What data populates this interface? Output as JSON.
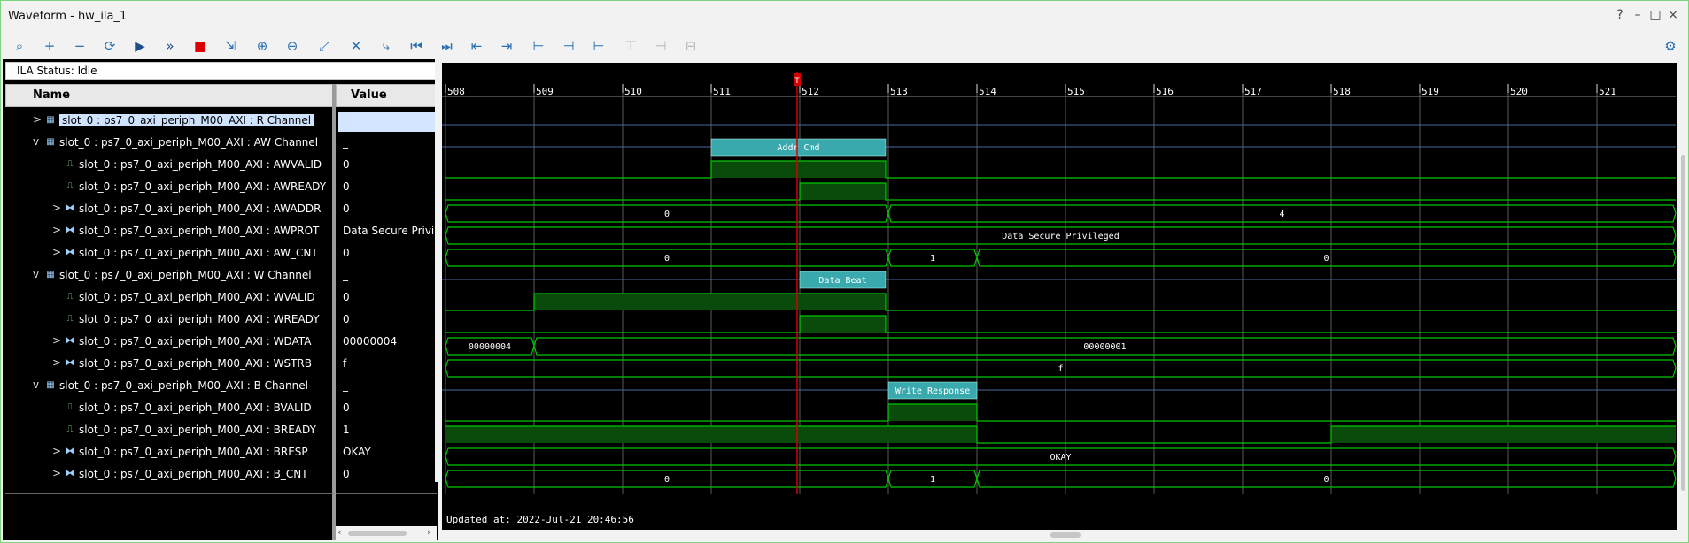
{
  "window": {
    "title": "Waveform - hw_ila_1",
    "controls": [
      "?",
      "–",
      "□",
      "×"
    ]
  },
  "toolbar": {
    "buttons": [
      {
        "name": "search-icon",
        "glyph": "⌕"
      },
      {
        "name": "add-icon",
        "glyph": "+"
      },
      {
        "name": "remove-icon",
        "glyph": "−"
      },
      {
        "name": "auto-retrigger-icon",
        "glyph": "⟳"
      },
      {
        "name": "run-trigger-icon",
        "glyph": "▶"
      },
      {
        "name": "run-immediate-icon",
        "glyph": "»"
      },
      {
        "name": "stop-icon",
        "glyph": "■"
      },
      {
        "name": "export-icon",
        "glyph": "⇲"
      },
      {
        "name": "zoom-in-icon",
        "glyph": "⊕"
      },
      {
        "name": "zoom-out-icon",
        "glyph": "⊖"
      },
      {
        "name": "zoom-fit-icon",
        "glyph": "⤢"
      },
      {
        "name": "cursor-icon",
        "glyph": "✕"
      },
      {
        "name": "go-to-cursor-icon",
        "glyph": "⤷"
      },
      {
        "name": "go-to-start-icon",
        "glyph": "⏮"
      },
      {
        "name": "go-to-end-icon",
        "glyph": "⏭"
      },
      {
        "name": "prev-transition-icon",
        "glyph": "⇤"
      },
      {
        "name": "next-transition-icon",
        "glyph": "⇥"
      },
      {
        "name": "add-marker-icon",
        "glyph": "⊢"
      },
      {
        "name": "prev-marker-icon",
        "glyph": "⊣"
      },
      {
        "name": "next-marker-icon",
        "glyph": "⊢"
      },
      {
        "name": "swap-cursors-icon",
        "glyph": "⊤"
      },
      {
        "name": "snap-icon",
        "glyph": "⊣"
      },
      {
        "name": "center-icon",
        "glyph": "⊟"
      }
    ],
    "settings_icon": "gear-icon"
  },
  "ila_status": "ILA Status:  Idle",
  "columns": {
    "name": "Name",
    "value": "Value"
  },
  "signals": [
    {
      "name": "slot_0 : ps7_0_axi_periph_M00_AXI : R Channel",
      "value": "_",
      "level": 0,
      "expander": ">",
      "icon": "channel",
      "selected": true
    },
    {
      "name": "slot_0 : ps7_0_axi_periph_M00_AXI : AW Channel",
      "value": "_",
      "level": 0,
      "expander": "v",
      "icon": "channel"
    },
    {
      "name": "slot_0 : ps7_0_axi_periph_M00_AXI : AWVALID",
      "value": "0",
      "level": 1,
      "expander": "",
      "icon": "bit"
    },
    {
      "name": "slot_0 : ps7_0_axi_periph_M00_AXI : AWREADY",
      "value": "0",
      "level": 1,
      "expander": "",
      "icon": "bit"
    },
    {
      "name": "slot_0 : ps7_0_axi_periph_M00_AXI : AWADDR",
      "value": "0",
      "level": 1,
      "expander": ">",
      "icon": "bus"
    },
    {
      "name": "slot_0 : ps7_0_axi_periph_M00_AXI : AWPROT",
      "value": "Data Secure Privileged",
      "level": 1,
      "expander": ">",
      "icon": "bus"
    },
    {
      "name": "slot_0 : ps7_0_axi_periph_M00_AXI : AW_CNT",
      "value": "0",
      "level": 1,
      "expander": ">",
      "icon": "bus"
    },
    {
      "name": "slot_0 : ps7_0_axi_periph_M00_AXI : W Channel",
      "value": "_",
      "level": 0,
      "expander": "v",
      "icon": "channel"
    },
    {
      "name": "slot_0 : ps7_0_axi_periph_M00_AXI : WVALID",
      "value": "0",
      "level": 1,
      "expander": "",
      "icon": "bit"
    },
    {
      "name": "slot_0 : ps7_0_axi_periph_M00_AXI : WREADY",
      "value": "0",
      "level": 1,
      "expander": "",
      "icon": "bit"
    },
    {
      "name": "slot_0 : ps7_0_axi_periph_M00_AXI : WDATA",
      "value": "00000004",
      "level": 1,
      "expander": ">",
      "icon": "bus"
    },
    {
      "name": "slot_0 : ps7_0_axi_periph_M00_AXI : WSTRB",
      "value": "f",
      "level": 1,
      "expander": ">",
      "icon": "bus"
    },
    {
      "name": "slot_0 : ps7_0_axi_periph_M00_AXI : B Channel",
      "value": "_",
      "level": 0,
      "expander": "v",
      "icon": "channel"
    },
    {
      "name": "slot_0 : ps7_0_axi_periph_M00_AXI : BVALID",
      "value": "0",
      "level": 1,
      "expander": "",
      "icon": "bit"
    },
    {
      "name": "slot_0 : ps7_0_axi_periph_M00_AXI : BREADY",
      "value": "1",
      "level": 1,
      "expander": "",
      "icon": "bit"
    },
    {
      "name": "slot_0 : ps7_0_axi_periph_M00_AXI : BRESP",
      "value": "OKAY",
      "level": 1,
      "expander": ">",
      "icon": "bus"
    },
    {
      "name": "slot_0 : ps7_0_axi_periph_M00_AXI : B_CNT",
      "value": "0",
      "level": 1,
      "expander": ">",
      "icon": "bus"
    }
  ],
  "timeline": {
    "ticks": [
      "508",
      "509",
      "510",
      "511",
      "512",
      "513",
      "514",
      "515",
      "516",
      "517",
      "518",
      "519",
      "520",
      "521"
    ],
    "cursor_sample": 511.97,
    "cursor_marker": "T"
  },
  "waves": [
    {
      "kind": "channel",
      "label": "",
      "span": []
    },
    {
      "kind": "channel",
      "label": "Addr Cmd",
      "span": [
        511,
        512.97
      ]
    },
    {
      "kind": "bit",
      "high": [
        [
          511,
          512.97
        ]
      ]
    },
    {
      "kind": "bit",
      "high": [
        [
          512,
          512.97
        ]
      ]
    },
    {
      "kind": "bus",
      "segments": [
        {
          "from": 508,
          "to": 513,
          "label": "0"
        },
        {
          "from": 513,
          "to": 522,
          "label": "4"
        }
      ]
    },
    {
      "kind": "bus",
      "segments": [
        {
          "from": 508,
          "to": 522,
          "label": "Data Secure Privileged"
        }
      ]
    },
    {
      "kind": "bus",
      "segments": [
        {
          "from": 508,
          "to": 513,
          "label": "0"
        },
        {
          "from": 513,
          "to": 514,
          "label": "1"
        },
        {
          "from": 514,
          "to": 522,
          "label": "0"
        }
      ]
    },
    {
      "kind": "channel",
      "label": "Data Beat",
      "span": [
        512,
        512.97
      ]
    },
    {
      "kind": "bit",
      "high": [
        [
          509,
          512.97
        ]
      ]
    },
    {
      "kind": "bit",
      "high": [
        [
          512,
          512.97
        ]
      ]
    },
    {
      "kind": "bus",
      "segments": [
        {
          "from": 508,
          "to": 509,
          "label": "00000004"
        },
        {
          "from": 509,
          "to": 522,
          "label": "00000001"
        }
      ]
    },
    {
      "kind": "bus",
      "segments": [
        {
          "from": 508,
          "to": 522,
          "label": "f"
        }
      ]
    },
    {
      "kind": "channel",
      "label": "Write Response",
      "span": [
        513,
        514
      ]
    },
    {
      "kind": "bit",
      "high": [
        [
          513,
          514
        ]
      ]
    },
    {
      "kind": "bit",
      "high": [
        [
          508,
          514
        ],
        [
          518,
          522
        ]
      ]
    },
    {
      "kind": "bus",
      "segments": [
        {
          "from": 508,
          "to": 522,
          "label": "OKAY"
        }
      ]
    },
    {
      "kind": "bus",
      "segments": [
        {
          "from": 508,
          "to": 513,
          "label": "0"
        },
        {
          "from": 513,
          "to": 514,
          "label": "1"
        },
        {
          "from": 514,
          "to": 522,
          "label": "0"
        }
      ]
    }
  ],
  "updated_at": "Updated at: 2022-Jul-21 20:46:56",
  "colors": {
    "wave": "#00c800",
    "wave_fill": "#0a4a0a",
    "channel": "#3aa9ad",
    "cursor": "#d40000",
    "grid": "#5a5a5a"
  }
}
